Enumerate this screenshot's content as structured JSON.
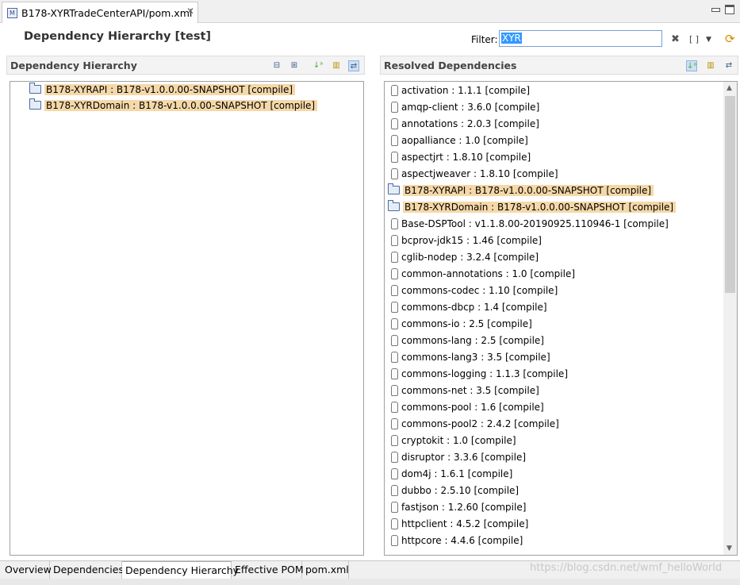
{
  "editor_tab": {
    "title": "B178-XYRTradeCenterAPI/pom.xml",
    "icon": "maven-file-icon"
  },
  "page_title": "Dependency Hierarchy [test]",
  "filter": {
    "label": "Filter:",
    "value": "XYR"
  },
  "left_panel": {
    "title": "Dependency Hierarchy",
    "items": [
      "B178-XYRAPI : B178-v1.0.0.00-SNAPSHOT [compile]",
      "B178-XYRDomain : B178-v1.0.0.00-SNAPSHOT [compile]"
    ]
  },
  "right_panel": {
    "title": "Resolved Dependencies",
    "items": [
      {
        "text": "activation : 1.1.1 [compile]",
        "hl": false
      },
      {
        "text": "amqp-client : 3.6.0 [compile]",
        "hl": false
      },
      {
        "text": "annotations : 2.0.3 [compile]",
        "hl": false
      },
      {
        "text": "aopalliance : 1.0 [compile]",
        "hl": false
      },
      {
        "text": "aspectjrt : 1.8.10 [compile]",
        "hl": false
      },
      {
        "text": "aspectjweaver : 1.8.10 [compile]",
        "hl": false
      },
      {
        "text": "B178-XYRAPI : B178-v1.0.0.00-SNAPSHOT [compile]",
        "hl": true
      },
      {
        "text": "B178-XYRDomain : B178-v1.0.0.00-SNAPSHOT [compile]",
        "hl": true
      },
      {
        "text": "Base-DSPTool : v1.1.8.00-20190925.110946-1 [compile]",
        "hl": false
      },
      {
        "text": "bcprov-jdk15 : 1.46 [compile]",
        "hl": false
      },
      {
        "text": "cglib-nodep : 3.2.4 [compile]",
        "hl": false
      },
      {
        "text": "common-annotations : 1.0 [compile]",
        "hl": false
      },
      {
        "text": "commons-codec : 1.10 [compile]",
        "hl": false
      },
      {
        "text": "commons-dbcp : 1.4 [compile]",
        "hl": false
      },
      {
        "text": "commons-io : 2.5 [compile]",
        "hl": false
      },
      {
        "text": "commons-lang : 2.5 [compile]",
        "hl": false
      },
      {
        "text": "commons-lang3 : 3.5 [compile]",
        "hl": false
      },
      {
        "text": "commons-logging : 1.1.3 [compile]",
        "hl": false
      },
      {
        "text": "commons-net : 3.5 [compile]",
        "hl": false
      },
      {
        "text": "commons-pool : 1.6 [compile]",
        "hl": false
      },
      {
        "text": "commons-pool2 : 2.4.2 [compile]",
        "hl": false
      },
      {
        "text": "cryptokit : 1.0 [compile]",
        "hl": false
      },
      {
        "text": "disruptor : 3.3.6 [compile]",
        "hl": false
      },
      {
        "text": "dom4j : 1.6.1 [compile]",
        "hl": false
      },
      {
        "text": "dubbo : 2.5.10 [compile]",
        "hl": false
      },
      {
        "text": "fastjson : 1.2.60 [compile]",
        "hl": false
      },
      {
        "text": "httpclient : 4.5.2 [compile]",
        "hl": false
      },
      {
        "text": "httpcore : 4.4.6 [compile]",
        "hl": false
      }
    ]
  },
  "bottom_tabs": [
    "Overview",
    "Dependencies",
    "Dependency Hierarchy",
    "Effective POM",
    "pom.xml"
  ],
  "selected_bottom_tab": "Dependency Hierarchy",
  "watermark": "https://blog.csdn.net/wmf_helloWorld",
  "colors": {
    "highlight": "#f5d8a8",
    "selection": "#3399ff",
    "toggle_active": "#cde0f5"
  }
}
